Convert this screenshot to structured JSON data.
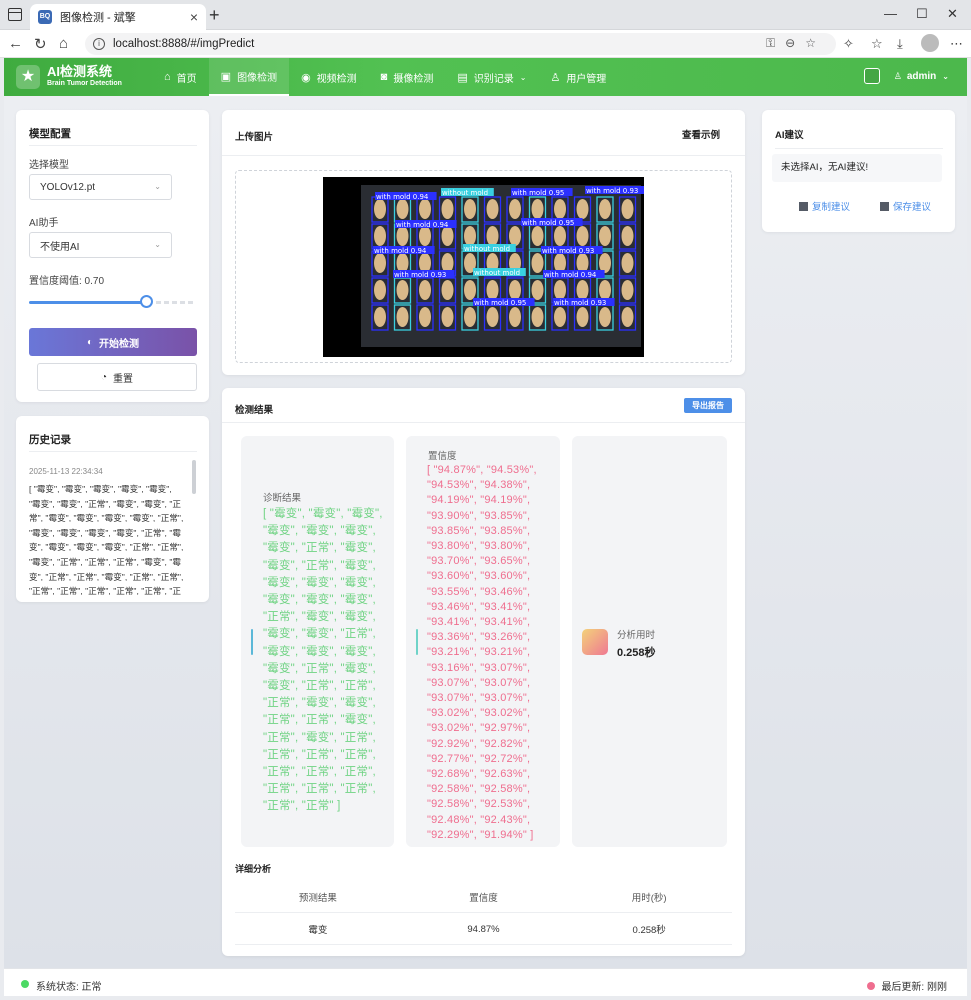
{
  "browser": {
    "tab_title": "图像检测 - 斌擎",
    "favicon_text": "BQ",
    "url": "localhost:8888/#/imgPredict"
  },
  "header": {
    "brand_title": "AI检测系统",
    "brand_subtitle": "Brain Tumor Detection",
    "nav": [
      {
        "label": "首页",
        "icon": "home-icon"
      },
      {
        "label": "图像检测",
        "icon": "image-icon"
      },
      {
        "label": "视频检测",
        "icon": "play-circle-icon"
      },
      {
        "label": "摄像检测",
        "icon": "camera-icon"
      },
      {
        "label": "识别记录",
        "icon": "document-icon"
      },
      {
        "label": "用户管理",
        "icon": "user-icon"
      }
    ],
    "active_nav": "图像检测",
    "user": "admin"
  },
  "model_config": {
    "title": "模型配置",
    "model_label": "选择模型",
    "model_value": "YOLOv12.pt",
    "ai_label": "AI助手",
    "ai_value": "不使用AI",
    "threshold_label": "置信度阈值: 0.70",
    "threshold_value": 0.7,
    "start_label": "开始检测",
    "reset_label": "重置"
  },
  "history": {
    "title": "历史记录",
    "timestamp": "2025-11-13 22:34:34",
    "entry_lines": [
      "[ \"霉变\", \"霉变\", \"霉变\", \"霉变\", \"霉变\",",
      "\"霉变\", \"霉变\", \"正常\", \"霉变\", \"霉变\", \"正",
      "常\", \"霉变\", \"霉变\", \"霉变\", \"霉变\", \"正常\",",
      "\"霉变\", \"霉变\", \"霉变\", \"霉变\", \"正常\", \"霉",
      "变\", \"霉变\", \"霉变\", \"霉变\", \"正常\", \"正常\",",
      "\"霉变\", \"正常\", \"正常\", \"正常\", \"霉变\", \"霉",
      "变\", \"正常\", \"正常\", \"霉变\", \"正常\", \"正常\",",
      "\"正常\", \"正常\", \"正常\", \"正常\", \"正常\", \"正"
    ]
  },
  "upload": {
    "title": "上传图片",
    "example_link": "查看示例"
  },
  "detection_image": {
    "background": "#000000",
    "kernel_color": "#d9b98a",
    "box_blue": "#2b30ff",
    "box_cyan": "#39d0e0",
    "labels": [
      "with mold 0.94",
      "without mold",
      "with mold 0.95",
      "with mold 0.93",
      "with mold 0.94"
    ]
  },
  "results": {
    "title": "检测结果",
    "export_label": "导出报告",
    "diagnosis_label": "诊断结果",
    "diagnosis_lines": [
      "[ \"霉变\", \"霉变\", \"霉变\",",
      "\"霉变\", \"霉变\", \"霉变\",",
      "\"霉变\", \"正常\", \"霉变\",",
      "\"霉变\", \"正常\", \"霉变\",",
      "\"霉变\", \"霉变\", \"霉变\",",
      "\"霉变\", \"霉变\", \"霉变\",",
      "\"正常\", \"霉变\", \"霉变\",",
      "\"霉变\", \"霉变\", \"正常\",",
      "\"霉变\", \"霉变\", \"霉变\",",
      "\"霉变\", \"正常\", \"霉变\",",
      "\"霉变\", \"正常\", \"正常\",",
      "\"正常\", \"霉变\", \"霉变\",",
      "\"正常\", \"正常\", \"霉变\",",
      "\"正常\", \"霉变\", \"正常\",",
      "\"正常\", \"正常\", \"正常\",",
      "\"正常\", \"正常\", \"正常\",",
      "\"正常\", \"正常\", \"正常\",",
      "\"正常\", \"正常\" ]"
    ],
    "confidence_label": "置信度",
    "confidence_lines": [
      "[ \"94.87%\", \"94.53%\",",
      "\"94.53%\", \"94.38%\",",
      "\"94.19%\", \"94.19%\",",
      "\"93.90%\", \"93.85%\",",
      "\"93.85%\", \"93.85%\",",
      "\"93.80%\", \"93.80%\",",
      "\"93.70%\", \"93.65%\",",
      "\"93.60%\", \"93.60%\",",
      "\"93.55%\", \"93.46%\",",
      "\"93.46%\", \"93.41%\",",
      "\"93.41%\", \"93.41%\",",
      "\"93.36%\", \"93.26%\",",
      "\"93.21%\", \"93.21%\",",
      "\"93.16%\", \"93.07%\",",
      "\"93.07%\", \"93.07%\",",
      "\"93.07%\", \"93.07%\",",
      "\"93.02%\", \"93.02%\",",
      "\"93.02%\", \"92.97%\",",
      "\"92.92%\", \"92.82%\",",
      "\"92.77%\", \"92.72%\",",
      "\"92.68%\", \"92.63%\",",
      "\"92.58%\", \"92.58%\",",
      "\"92.58%\", \"92.53%\",",
      "\"92.48%\", \"92.43%\",",
      "\"92.29%\", \"91.94%\" ]"
    ],
    "time_label": "分析用时",
    "time_value": "0.258秒",
    "colors": {
      "diagnosis": "#6fd383",
      "confidence": "#ef6e8f"
    }
  },
  "details": {
    "title": "详细分析",
    "columns": [
      "预测结果",
      "置信度",
      "用时(秒)"
    ],
    "rows": [
      [
        "霉变",
        "94.87%",
        "0.258秒"
      ]
    ]
  },
  "ai_advice": {
    "title": "AI建议",
    "message": "未选择AI，无AI建议!",
    "copy_label": "复制建议",
    "save_label": "保存建议"
  },
  "status": {
    "left": "系统状态: 正常",
    "right": "最后更新: 刚刚",
    "left_color": "#4cd964",
    "right_color": "#ef6e8f"
  }
}
